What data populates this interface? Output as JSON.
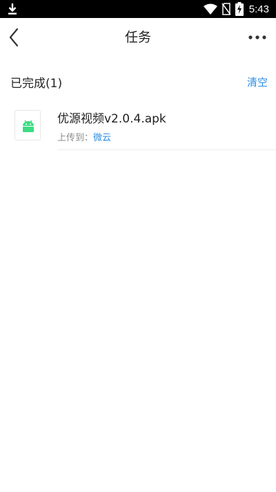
{
  "status_bar": {
    "time": "5:43",
    "icons": [
      "download-icon",
      "wifi-icon",
      "no-sim-icon",
      "battery-charging-icon"
    ]
  },
  "header": {
    "title": "任务",
    "back_icon": "chevron-left-icon",
    "more_icon": "more-horizontal-icon"
  },
  "section": {
    "title": "已完成(1)",
    "clear_label": "清空"
  },
  "tasks": [
    {
      "icon": "android-icon",
      "file_name": "优源视频v2.0.4.apk",
      "upload_label": "上传到：",
      "upload_destination": "微云"
    }
  ],
  "colors": {
    "accent": "#2b8de6",
    "android_green": "#3ddc84",
    "status_bar_bg": "#000000"
  }
}
